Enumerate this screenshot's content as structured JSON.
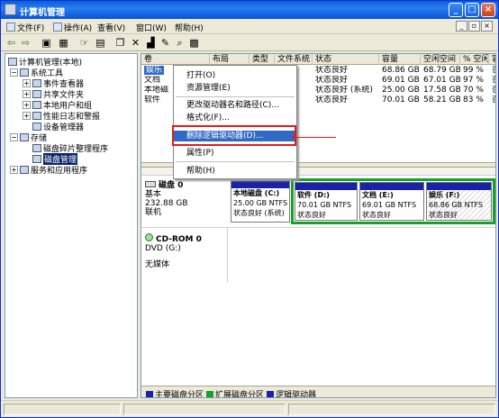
{
  "window": {
    "title": "计算机管理",
    "buttons": {
      "min": "_",
      "max": "□",
      "close": "×"
    }
  },
  "menubar": {
    "items": [
      {
        "label": "文件(F)"
      },
      {
        "label": "操作(A)"
      },
      {
        "label": "查看(V)"
      },
      {
        "label": "窗口(W)"
      },
      {
        "label": "帮助(H)"
      }
    ],
    "mdi": [
      "_",
      "▫",
      "×"
    ]
  },
  "toolbar": {
    "icons": [
      "back-icon",
      "forward-icon",
      "up-icon",
      "show-tree-icon",
      "properties-icon",
      "help-icon",
      "refresh-icon",
      "delete-icon",
      "open-icon",
      "settings-icon",
      "zoom-icon",
      "help2-icon"
    ],
    "glyphs": [
      "⇦",
      "⇨",
      "▣",
      "▦",
      "☞",
      "▤",
      "❐",
      "✕",
      "▟",
      "✎",
      "⌕",
      "▩"
    ]
  },
  "tree": {
    "items": [
      {
        "label": "计算机管理(本地)",
        "level": 0,
        "toggle": ""
      },
      {
        "label": "系统工具",
        "level": 1,
        "toggle": "−"
      },
      {
        "label": "事件查看器",
        "level": 2,
        "toggle": "+"
      },
      {
        "label": "共享文件夹",
        "level": 2,
        "toggle": "+"
      },
      {
        "label": "本地用户和组",
        "level": 2,
        "toggle": "+"
      },
      {
        "label": "性能日志和警报",
        "level": 2,
        "toggle": "+"
      },
      {
        "label": "设备管理器",
        "level": 2,
        "toggle": ""
      },
      {
        "label": "存储",
        "level": 1,
        "toggle": "−"
      },
      {
        "label": "磁盘碎片整理程序",
        "level": 2,
        "toggle": ""
      },
      {
        "label": "磁盘管理",
        "level": 2,
        "toggle": "",
        "selected": true
      },
      {
        "label": "服务和应用程序",
        "level": 1,
        "toggle": "+"
      }
    ]
  },
  "volume_list": {
    "columns": [
      "卷",
      "布局",
      "类型",
      "文件系统",
      "状态",
      "容量",
      "空闲空间",
      "% 空闲",
      "容"
    ],
    "rows": [
      {
        "volume": "娱乐",
        "status": "状态良好",
        "capacity": "68.86 GB",
        "free": "68.79 GB",
        "pct": "99 %",
        "extra": "否"
      },
      {
        "volume": "文档",
        "status": "状态良好",
        "capacity": "69.01 GB",
        "free": "67.01 GB",
        "pct": "97 %",
        "extra": "否"
      },
      {
        "volume": "本地磁",
        "status": "状态良好 (系统)",
        "capacity": "25.00 GB",
        "free": "17.58 GB",
        "pct": "70 %",
        "extra": "否"
      },
      {
        "volume": "软件",
        "status": "状态良好",
        "capacity": "70.01 GB",
        "free": "58.21 GB",
        "pct": "83 %",
        "extra": "否"
      }
    ]
  },
  "context_menu": {
    "items": [
      {
        "label": "打开(O)"
      },
      {
        "label": "资源管理(E)"
      },
      {
        "label": "更改驱动器名和路径(C)..."
      },
      {
        "label": "格式化(F)..."
      },
      {
        "label": "删除逻辑驱动器(D)..."
      },
      {
        "label": "属性(P)"
      },
      {
        "label": "帮助(H)"
      }
    ],
    "highlighted": "删除逻辑驱动器(D)..."
  },
  "disks": [
    {
      "name": "磁盘 0",
      "type": "基本",
      "size": "232.88 GB",
      "state": "联机",
      "partitions": [
        {
          "name": "本地磁盘 (C:)",
          "size": "25.00 GB NTFS",
          "status": "状态良好 (系统)"
        },
        {
          "name": "软件 (D:)",
          "size": "70.01 GB NTFS",
          "status": "状态良好"
        },
        {
          "name": "文档 (E:)",
          "size": "69.01 GB NTFS",
          "status": "状态良好"
        },
        {
          "name": "娱乐 (F:)",
          "size": "68.86 GB NTFS",
          "status": "状态良好"
        }
      ]
    },
    {
      "name": "CD-ROM 0",
      "type": "DVD (G:)",
      "size": "",
      "state": "无媒体",
      "partitions": []
    }
  ],
  "legend": [
    {
      "label": "主要磁盘分区",
      "color": "#1a22a8"
    },
    {
      "label": "扩展磁盘分区",
      "color": "#16a12a"
    },
    {
      "label": "逻辑驱动器",
      "color": "#1a22a8"
    }
  ],
  "colors": {
    "accent": "#316ac5",
    "highlight_box": "#e21b1b",
    "extended": "#16a12a",
    "primary": "#1a22a8"
  }
}
